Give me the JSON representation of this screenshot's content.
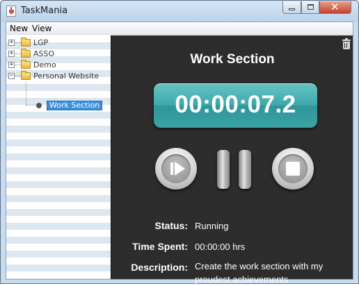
{
  "window": {
    "title": "TaskMania",
    "close_glyph": "✕"
  },
  "menubar": {
    "items": [
      "New",
      "View"
    ]
  },
  "tree": {
    "nodes": [
      {
        "label": "LGP",
        "toggle": "+"
      },
      {
        "label": "ASSO",
        "toggle": "+"
      },
      {
        "label": "Demo",
        "toggle": "+"
      },
      {
        "label": "Personal Website",
        "toggle": "−"
      }
    ],
    "selected_child": "Work Section"
  },
  "detail": {
    "title": "Work Section",
    "timer": "00:00:07.2",
    "status_label": "Status:",
    "status_value": "Running",
    "time_spent_label": "Time Spent:",
    "time_spent_value": "00:00:00 hrs",
    "description_label": "Description:",
    "description_value": "Create the work section with my proudest achievements"
  },
  "colors": {
    "timer_accent": "#3fa9ab",
    "panel_background": "#2b2b2b",
    "selection": "#3a8fe0"
  }
}
